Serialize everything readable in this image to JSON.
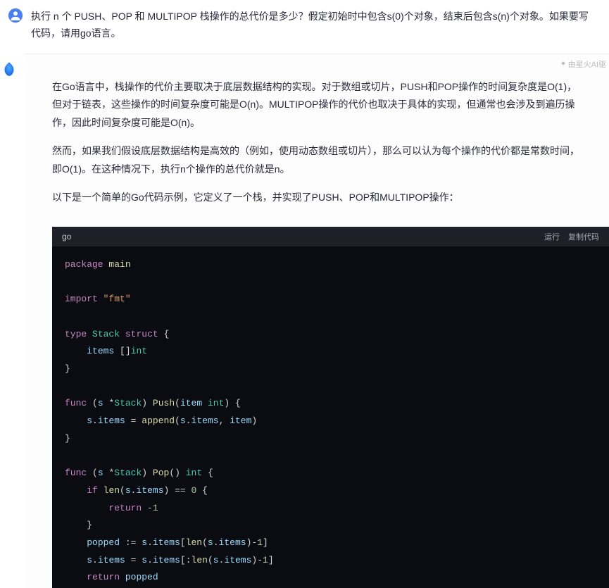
{
  "question": {
    "text": "执行 n 个 PUSH、POP 和 MULTIPOP 栈操作的总代价是多少？假定初始时中包含s(0)个对象，结束后包含s(n)个对象。如果要写代码，请用go语言。"
  },
  "powered_by": "由星火AI驱",
  "answer": {
    "paragraphs": [
      "在Go语言中，栈操作的代价主要取决于底层数据结构的实现。对于数组或切片，PUSH和POP操作的时间复杂度是O(1)，但对于链表，这些操作的时间复杂度可能是O(n)。MULTIPOP操作的代价也取决于具体的实现，但通常也会涉及到遍历操作，因此时间复杂度可能是O(n)。",
      "然而，如果我们假设底层数据结构是高效的（例如，使用动态数组或切片），那么可以认为每个操作的代价都是常数时间，即O(1)。在这种情况下，执行n个操作的总代价就是n。",
      "以下是一个简单的Go代码示例，它定义了一个栈，并实现了PUSH、POP和MULTIPOP操作："
    ]
  },
  "code": {
    "lang": "go",
    "run_label": "运行",
    "copy_label": "复制代码",
    "tokens": {
      "package": "package",
      "main": "main",
      "import": "import",
      "fmt": "\"fmt\"",
      "type": "type",
      "Stack": "Stack",
      "struct": "struct",
      "items": "items",
      "slice_int": "[]",
      "int": "int",
      "func": "func",
      "s": "s",
      "star": "*",
      "Push": "Push",
      "item": "item",
      "append": "append",
      "Pop": "Pop",
      "if": "if",
      "len": "len",
      "eqeq": " == ",
      "zero": "0",
      "return": "return",
      "neg1": "-1",
      "popped": "popped",
      "assign": " := ",
      "minus1": "1"
    }
  }
}
